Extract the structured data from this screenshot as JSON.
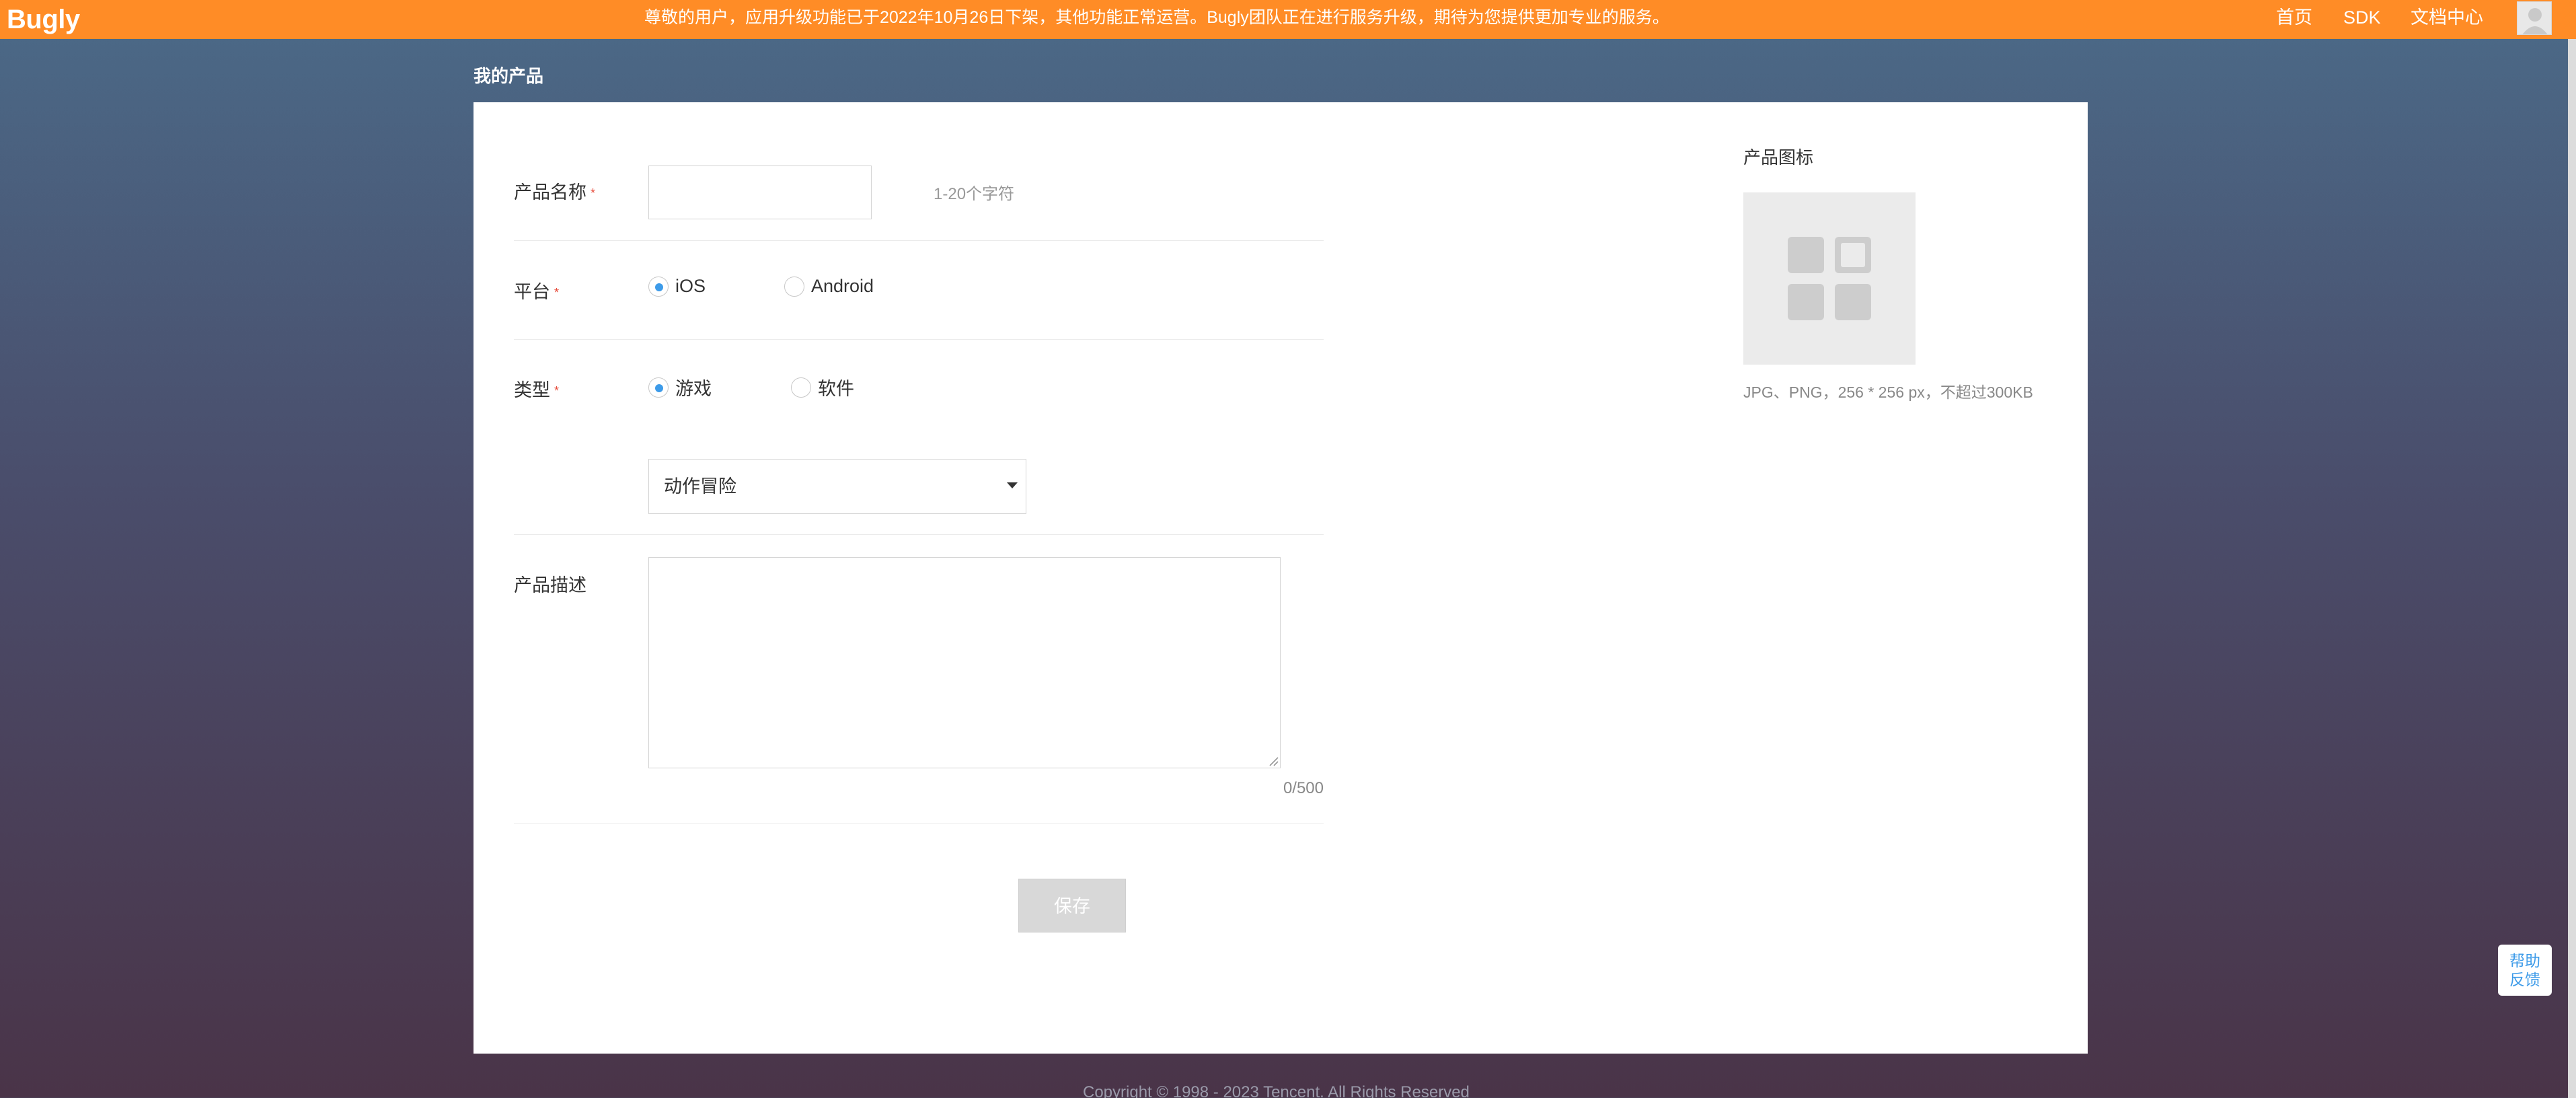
{
  "header": {
    "logo": "Bugly",
    "notice": "尊敬的用户，应用升级功能已于2022年10月26日下架，其他功能正常运营。Bugly团队正在进行服务升级，期待为您提供更加专业的服务。",
    "nav": {
      "home": "首页",
      "sdk": "SDK",
      "docs": "文档中心"
    }
  },
  "page": {
    "title": "我的产品"
  },
  "form": {
    "name": {
      "label": "产品名称",
      "value": "",
      "hint": "1-20个字符"
    },
    "platform": {
      "label": "平台",
      "options": [
        "iOS",
        "Android"
      ],
      "selected": "iOS"
    },
    "type": {
      "label": "类型",
      "options": [
        "游戏",
        "软件"
      ],
      "selected": "游戏",
      "category": "动作冒险"
    },
    "description": {
      "label": "产品描述",
      "value": "",
      "count": "0/500"
    },
    "save_label": "保存",
    "required_mark": "*"
  },
  "icon_panel": {
    "title": "产品图标",
    "spec": "JPG、PNG，256 * 256 px，不超过300KB"
  },
  "footer": {
    "copyright": "Copyright © 1998 - 2023 Tencent. All Rights Reserved"
  },
  "help": {
    "line1": "帮助",
    "line2": "反馈"
  },
  "colors": {
    "topbar": "#ff8c26",
    "accent": "#3d9be9",
    "required": "#e74c3c"
  }
}
